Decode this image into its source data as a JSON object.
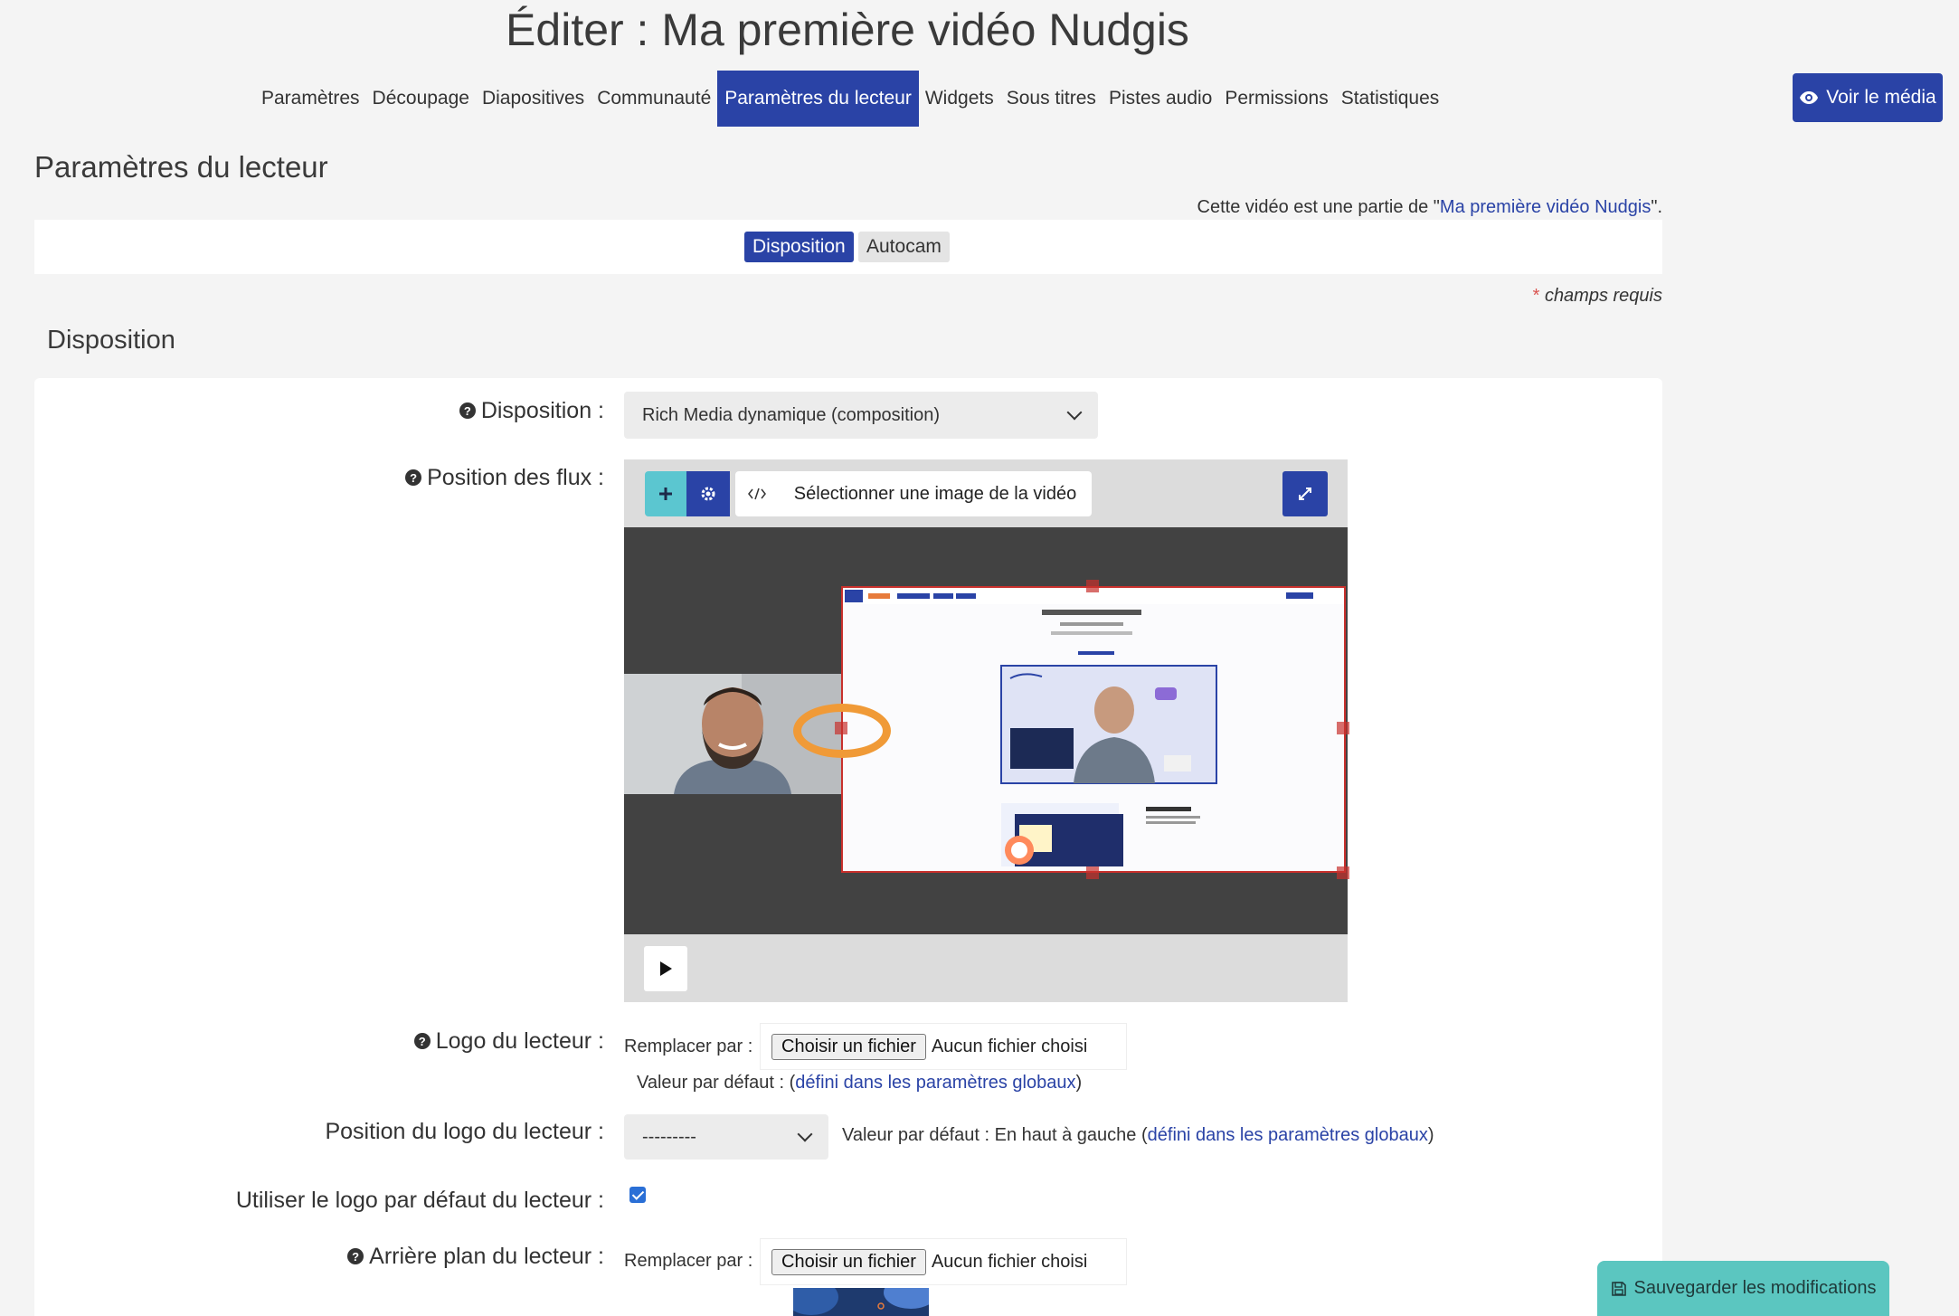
{
  "header": {
    "title": "Éditer : Ma première vidéo Nudgis",
    "view_media": "Voir le média"
  },
  "nav": {
    "items": [
      {
        "label": "Paramètres"
      },
      {
        "label": "Découpage"
      },
      {
        "label": "Diapositives"
      },
      {
        "label": "Communauté"
      },
      {
        "label": "Paramètres du lecteur",
        "active": true
      },
      {
        "label": "Widgets"
      },
      {
        "label": "Sous titres"
      },
      {
        "label": "Pistes audio"
      },
      {
        "label": "Permissions"
      },
      {
        "label": "Statistiques"
      }
    ]
  },
  "page": {
    "section_title": "Paramètres du lecteur",
    "partof_prefix": "Cette vidéo est une partie de \"",
    "partof_link": "Ma première vidéo Nudgis",
    "partof_suffix": "\".",
    "tabs": {
      "active": "Disposition",
      "inactive": "Autocam"
    },
    "required_label": "champs requis",
    "required_star": "*",
    "subsection_title": "Disposition"
  },
  "form": {
    "layout_label": "Disposition :",
    "layout_value": "Rich Media dynamique (composition)",
    "streams_label": "Position des flux :",
    "select_image": "Sélectionner une image de la vidéo",
    "logo_label": "Logo du lecteur :",
    "replace_by": "Remplacer par :",
    "choose_file": "Choisir un fichier",
    "no_file": "Aucun fichier choisi",
    "default_value_prefix": "Valeur par défaut : (",
    "global_settings_link": "défini dans les paramètres globaux",
    "default_value_suffix": ")",
    "logo_position_label": "Position du logo du lecteur :",
    "logo_position_value": "---------",
    "logo_position_default_prefix": "Valeur par défaut : En haut à gauche (",
    "use_default_logo_label": "Utiliser le logo par défaut du lecteur :",
    "use_default_logo_checked": true,
    "background_label": "Arrière plan du lecteur :"
  },
  "footer": {
    "save": "Sauvegarder les modifications"
  },
  "colors": {
    "primary": "#2a43a6",
    "teal": "#5bc6c0",
    "orange": "#f09a37",
    "red": "#c8302c"
  }
}
